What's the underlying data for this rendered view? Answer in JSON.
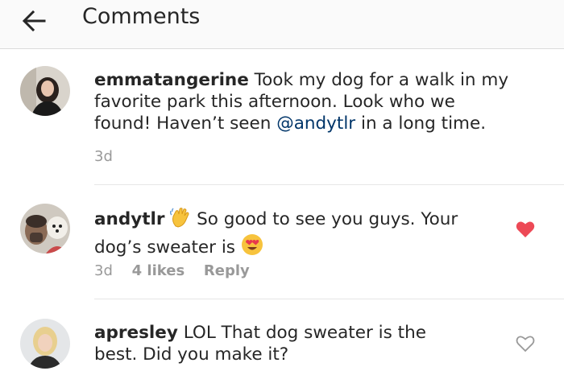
{
  "header": {
    "title": "Comments",
    "back_icon": "arrow-left-icon"
  },
  "comments": [
    {
      "username": "emmatangerine",
      "text_before": " Took my dog for a walk in my favorite park this afternoon. Look who we found! Haven’t seen ",
      "mention": "@andytlr",
      "text_after": " in a long time.",
      "time": "3d"
    },
    {
      "username": "andytlr",
      "wave_emoji": "waving-hand-icon",
      "text_1": " So good to see you guys. Your dog’s sweater is ",
      "heart_eyes_emoji": "heart-eyes-icon",
      "time": "3d",
      "likes": "4 likes",
      "reply_label": "Reply",
      "liked": true
    },
    {
      "username": "apresley",
      "text": " LOL That dog sweater is the best. Did you make it?",
      "liked": false
    }
  ],
  "colors": {
    "heart_liked": "#ed4956",
    "mention": "#003569",
    "meta": "#999999"
  }
}
